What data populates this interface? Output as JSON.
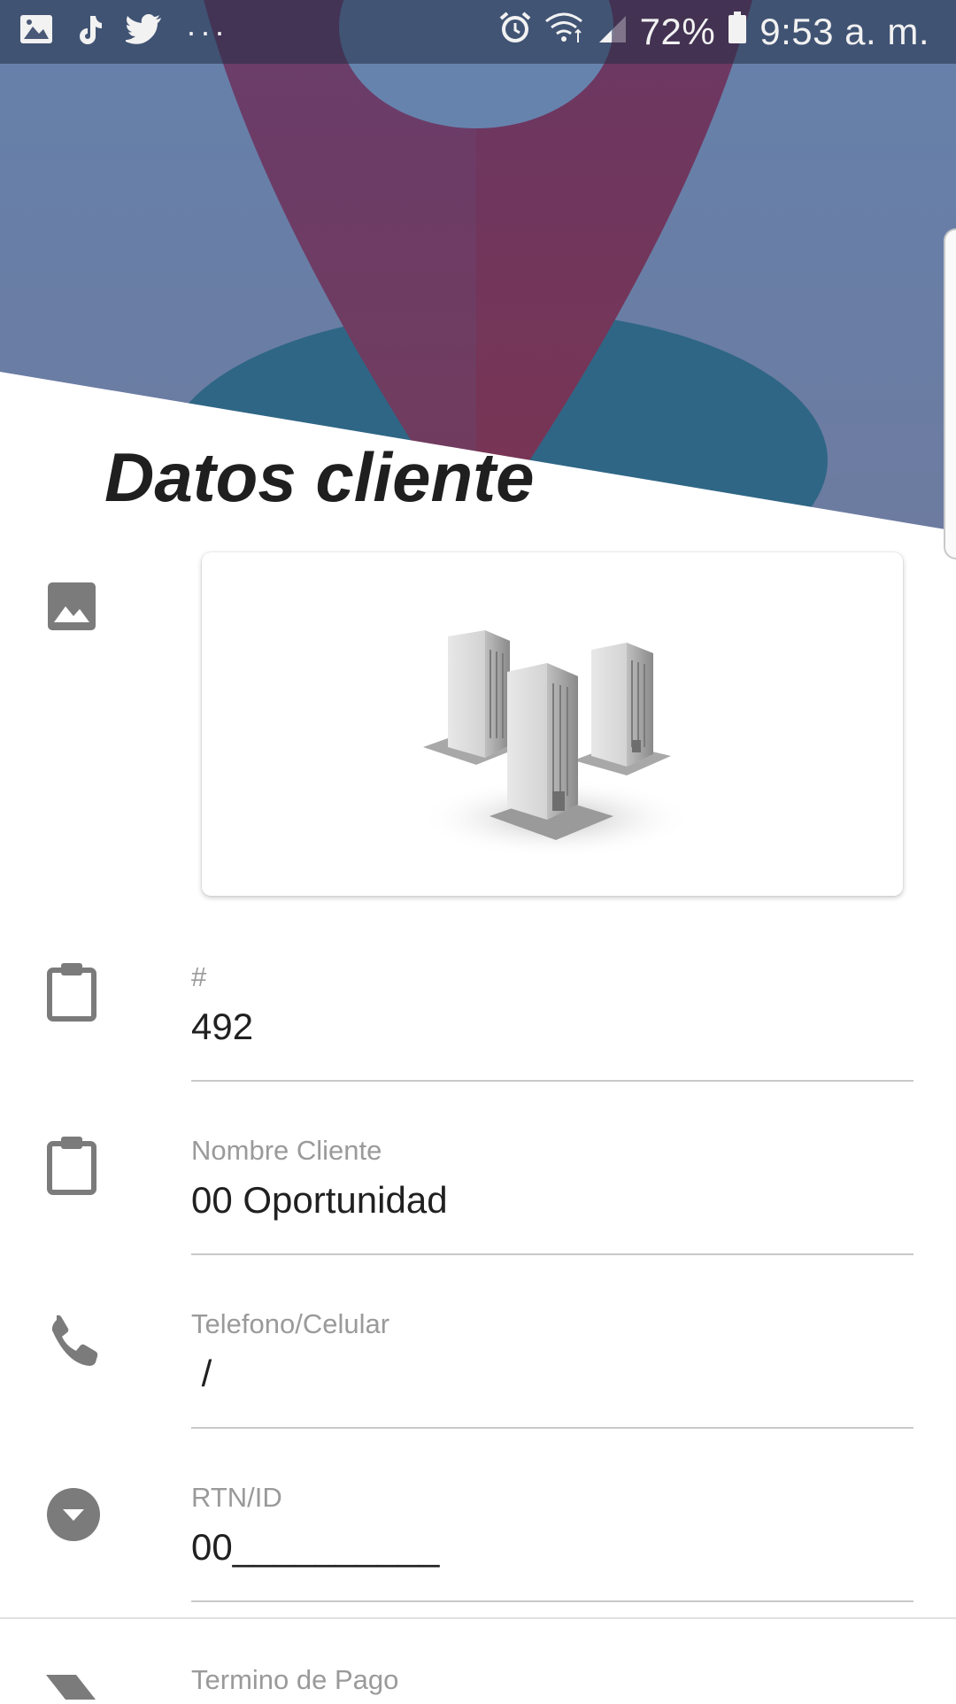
{
  "status_bar": {
    "battery": "72%",
    "time": "9:53 a. m.",
    "left_icons": [
      "gallery-icon",
      "tiktok-icon",
      "twitter-icon",
      "more-dots-icon"
    ],
    "right_icons": [
      "alarm-icon",
      "wifi-icon",
      "signal-icon",
      "battery-icon"
    ],
    "more": "···"
  },
  "header": {
    "title": "Datos cliente",
    "colors": {
      "sky": "#6a82a8",
      "pin": "#6d3d63",
      "ground": "#2e6482"
    }
  },
  "image_field": {
    "icon": "image-icon",
    "card_content": "buildings-image"
  },
  "fields": [
    {
      "icon": "clipboard-icon",
      "label": "#",
      "value": "492"
    },
    {
      "icon": "clipboard-icon",
      "label": "Nombre Cliente",
      "value": "00 Oportunidad"
    },
    {
      "icon": "phone-icon",
      "label": "Telefono/Celular",
      "value": " /"
    },
    {
      "icon": "dropdown-circle-icon",
      "label": "RTN/ID",
      "value": "00__________"
    },
    {
      "icon": "label-arrow-icon",
      "label": "Termino de Pago",
      "value": ""
    }
  ]
}
